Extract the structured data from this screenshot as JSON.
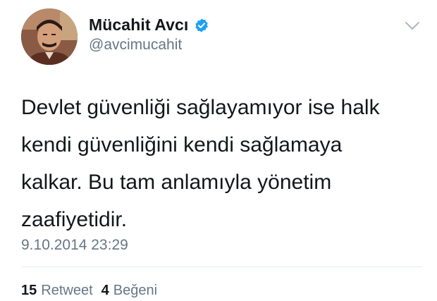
{
  "user": {
    "display_name": "Mücahit Avcı",
    "handle": "@avcimucahit",
    "verified": true
  },
  "tweet": {
    "lines": [
      "Devlet güvenliği sağlayamıyor ise halk",
      "kendi güvenliğini kendi sağlamaya",
      "kalkar. Bu tam anlamıyla yönetim",
      "zaafiyetidir."
    ],
    "timestamp": "9.10.2014 23:29"
  },
  "stats": {
    "retweets": {
      "count": "15",
      "label": "Retweet"
    },
    "likes": {
      "count": "4",
      "label": "Beğeni"
    }
  },
  "icons": {
    "verified": "verified-badge-icon",
    "caret": "chevron-down-icon"
  },
  "colors": {
    "text_primary": "#14171a",
    "text_secondary": "#657786",
    "verified_blue": "#1da1f2",
    "divider": "#e6ecf0"
  }
}
